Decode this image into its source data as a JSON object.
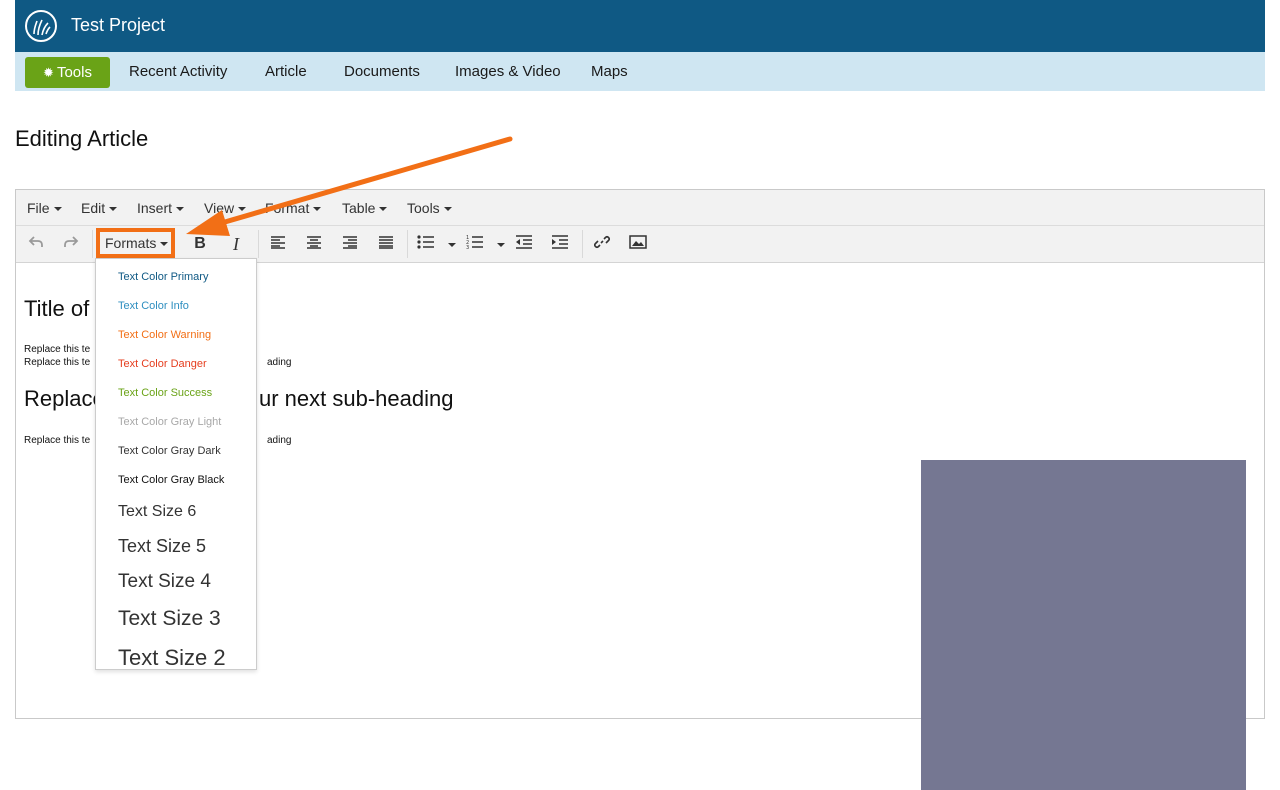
{
  "header": {
    "title": "Test Project",
    "logo_icon": "grass-logo-icon",
    "bg_color": "#0f5984"
  },
  "nav": {
    "tools_label": "Tools",
    "tools_icon": "gear-icon",
    "tools_color": "#6aa317",
    "items": [
      "Recent Activity",
      "Article",
      "Documents",
      "Images & Video",
      "Maps"
    ]
  },
  "page": {
    "heading": "Editing Article"
  },
  "editor": {
    "menus": [
      "File",
      "Edit",
      "Insert",
      "View",
      "Format",
      "Table",
      "Tools"
    ],
    "toolbar": {
      "formats_label": "Formats",
      "icons": [
        "undo-icon",
        "redo-icon",
        "bold-icon",
        "italic-icon",
        "align-left-icon",
        "align-center-icon",
        "align-right-icon",
        "align-justify-icon",
        "bullet-list-icon",
        "numbered-list-icon",
        "outdent-icon",
        "indent-icon",
        "link-icon",
        "image-icon"
      ]
    },
    "content": {
      "title_visible": "Title of",
      "line1_left": "Replace this te",
      "line2_left": "Replace this te",
      "line2_right": "ading",
      "subheading_left": "Replace",
      "subheading_right": "ur next sub-heading",
      "line3_left": "Replace this te",
      "line3_right": "ading",
      "image_color": "#757792"
    },
    "formats_dropdown": [
      {
        "label": "Text Color Primary",
        "color": "#0f5984"
      },
      {
        "label": "Text Color Info",
        "color": "#2f8fc0"
      },
      {
        "label": "Text Color Warning",
        "color": "#f26f16"
      },
      {
        "label": "Text Color Danger",
        "color": "#e53d1e"
      },
      {
        "label": "Text Color Success",
        "color": "#6aa317"
      },
      {
        "label": "Text Color Gray Light",
        "color": "#a8a8a8"
      },
      {
        "label": "Text Color Gray Dark",
        "color": "#333333"
      },
      {
        "label": "Text Color Gray Black",
        "color": "#111111"
      },
      {
        "label": "Text Size 6",
        "color": "#333333"
      },
      {
        "label": "Text Size 5",
        "color": "#333333"
      },
      {
        "label": "Text Size 4",
        "color": "#333333"
      },
      {
        "label": "Text Size 3",
        "color": "#333333"
      },
      {
        "label": "Text Size 2",
        "color": "#333333"
      }
    ]
  },
  "annotation": {
    "color": "#f26f16"
  }
}
